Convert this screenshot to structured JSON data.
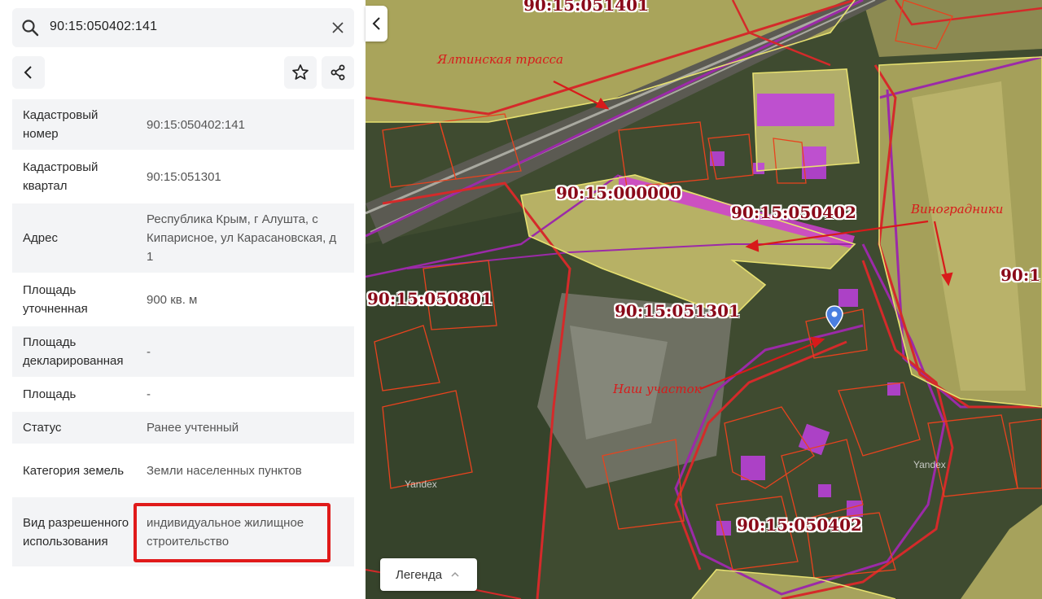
{
  "search": {
    "query": "90:15:050402:141"
  },
  "icons": {
    "search": "search-icon",
    "clear": "close-icon",
    "back": "chevron-left-icon",
    "favorite": "star-icon",
    "share": "share-icon"
  },
  "details": [
    {
      "label": "Кадастровый номер",
      "value": "90:15:050402:141"
    },
    {
      "label": "Кадастровый квартал",
      "value": "90:15:051301"
    },
    {
      "label": "Адрес",
      "value": "Республика Крым, г Алушта, с Кипарисное, ул Карасановская, д 1"
    },
    {
      "label": "Площадь уточненная",
      "value": "900 кв. м"
    },
    {
      "label": "Площадь декларированная",
      "value": "-"
    },
    {
      "label": "Площадь",
      "value": "-"
    },
    {
      "label": "Статус",
      "value": "Ранее учтенный"
    },
    {
      "label": "Категория земель",
      "value": "Земли населенных пунктов"
    },
    {
      "label": "Вид разрешенного использования",
      "value": "индивидуальное жилищное строительство"
    }
  ],
  "map": {
    "cadastral_labels": {
      "top": "90:15:051401",
      "center_left": "90:15:000000",
      "center_right": "90:15:050402",
      "left": "90:15:050801",
      "middle": "90:15:051301",
      "bottom": "90:15:050402",
      "right_edge": "90:1"
    },
    "annotations": {
      "highway": "Ялтинская трасса",
      "vineyards": "Виноградники",
      "our_plot": "Наш участок"
    },
    "watermarks": {
      "yandex_1": "Yandex",
      "yandex_2": "Yandex"
    },
    "legend_label": "Легенда",
    "colors": {
      "parcel_border": "#e8431e",
      "quarter_border": "#d42a2a",
      "zone_border": "#9b2aa8",
      "building_fill": "#c040e0",
      "pin": "#4a7fe0",
      "highlight": "#e01a1a"
    }
  }
}
